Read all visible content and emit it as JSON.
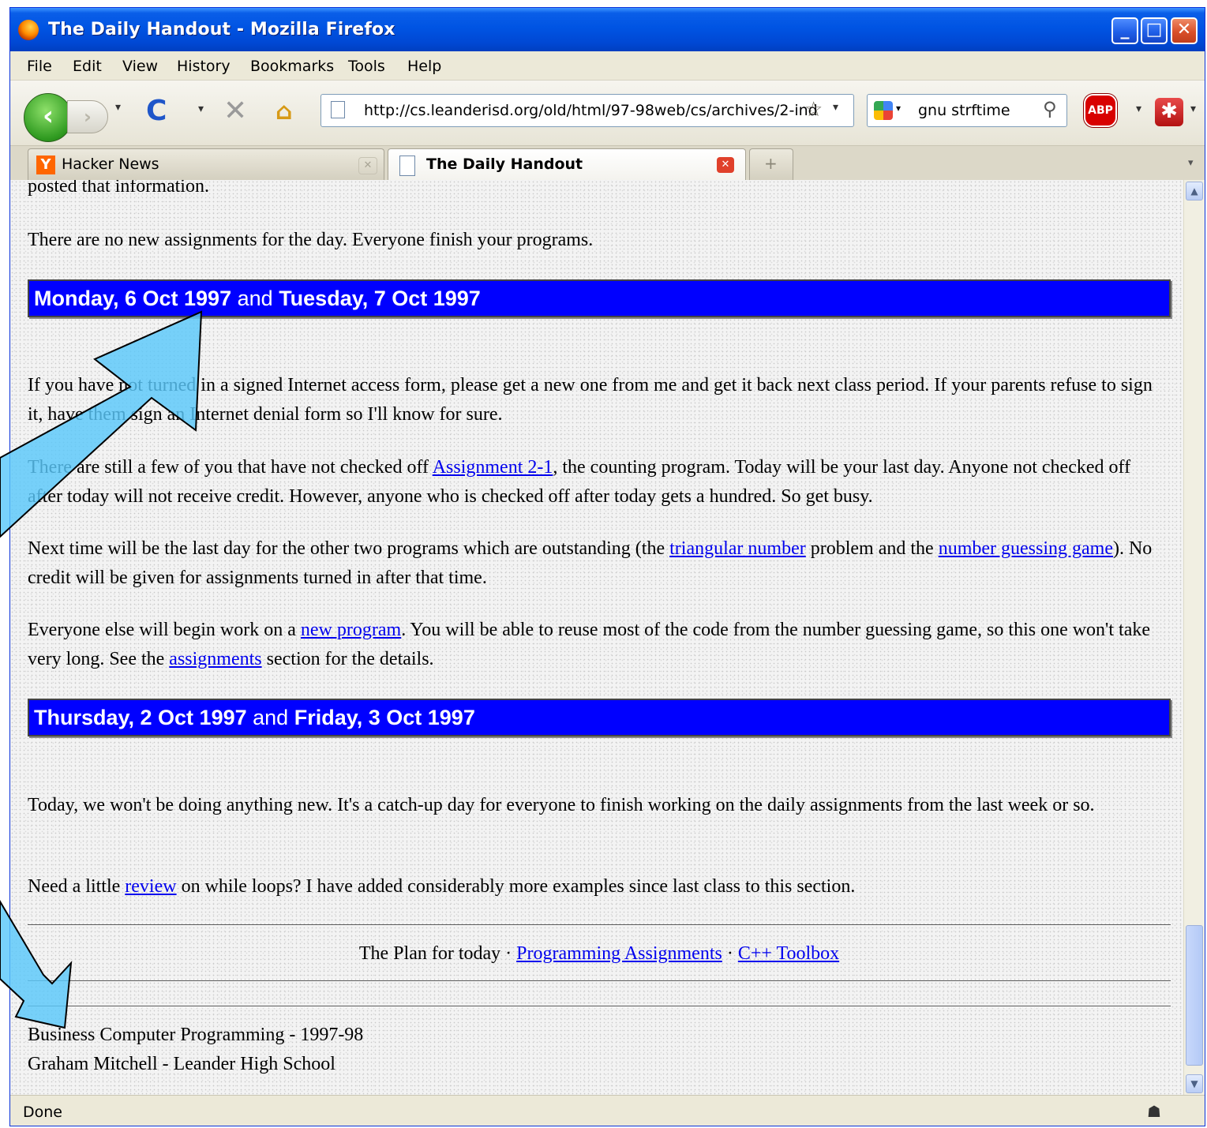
{
  "window": {
    "title": "The Daily Handout - Mozilla Firefox"
  },
  "menu": [
    "File",
    "Edit",
    "View",
    "History",
    "Bookmarks",
    "Tools",
    "Help"
  ],
  "nav": {
    "url": "http://cs.leanderisd.org/old/html/97-98web/cs/archives/2-ind",
    "search_query": "gnu strftime",
    "abp_label": "ABP"
  },
  "tabs": [
    {
      "label": "Hacker News",
      "icon": "Y"
    },
    {
      "label": "The Daily Handout"
    }
  ],
  "content": {
    "top_fragment": "posted that information.",
    "p_no_assignments": "There are no new assignments for the day. Everyone finish your programs.",
    "header1": {
      "date1": "Monday, 6 Oct 1997",
      "and": "and",
      "date2": "Tuesday, 7 Oct 1997"
    },
    "p1": "If you have not turned in a signed Internet access form, please get a new one from me and get it back next class period. If your parents refuse to sign it, have them sign an Internet denial form so I'll know for sure.",
    "p2": {
      "pre": "There are still a few of you that have not checked off ",
      "link": "Assignment 2-1",
      "post": ", the counting program. Today will be your last day. Anyone not checked off after today will not receive credit. However, anyone who is checked off after today gets a hundred. So get busy."
    },
    "p3": {
      "pre": "Next time will be the last day for the other two programs which are outstanding (the ",
      "link1": "triangular number",
      "mid": " problem and the ",
      "link2": "number guessing game",
      "post": "). No credit will be given for assignments turned in after that time."
    },
    "p4": {
      "pre": "Everyone else will begin work on a ",
      "link1": "new program",
      "mid": ". You will be able to reuse most of the code from the number guessing game, so this one won't take very long. See the ",
      "link2": "assignments",
      "post": " section for the details."
    },
    "header2": {
      "date1": "Thursday, 2 Oct 1997",
      "and": "and",
      "date2": "Friday, 3 Oct 1997"
    },
    "p5": "Today, we won't be doing anything new. It's a catch-up day for everyone to finish working on the daily assignments from the last week or so.",
    "p6": {
      "pre": "Need a little ",
      "link": "review",
      "post": " on while loops? I have added considerably more examples since last class to this section."
    },
    "footer_nav": {
      "text": "The Plan for today",
      "sep": "·",
      "link1": "Programming Assignments",
      "link2": "C++ Toolbox"
    },
    "footer1": "Business Computer Programming - 1997-98",
    "footer2": "Graham Mitchell - Leander High School"
  },
  "status": {
    "text": "Done"
  },
  "colors": {
    "header_bar": "#0000ff",
    "link": "#0000ee",
    "arrow": "#5ac8fa"
  }
}
